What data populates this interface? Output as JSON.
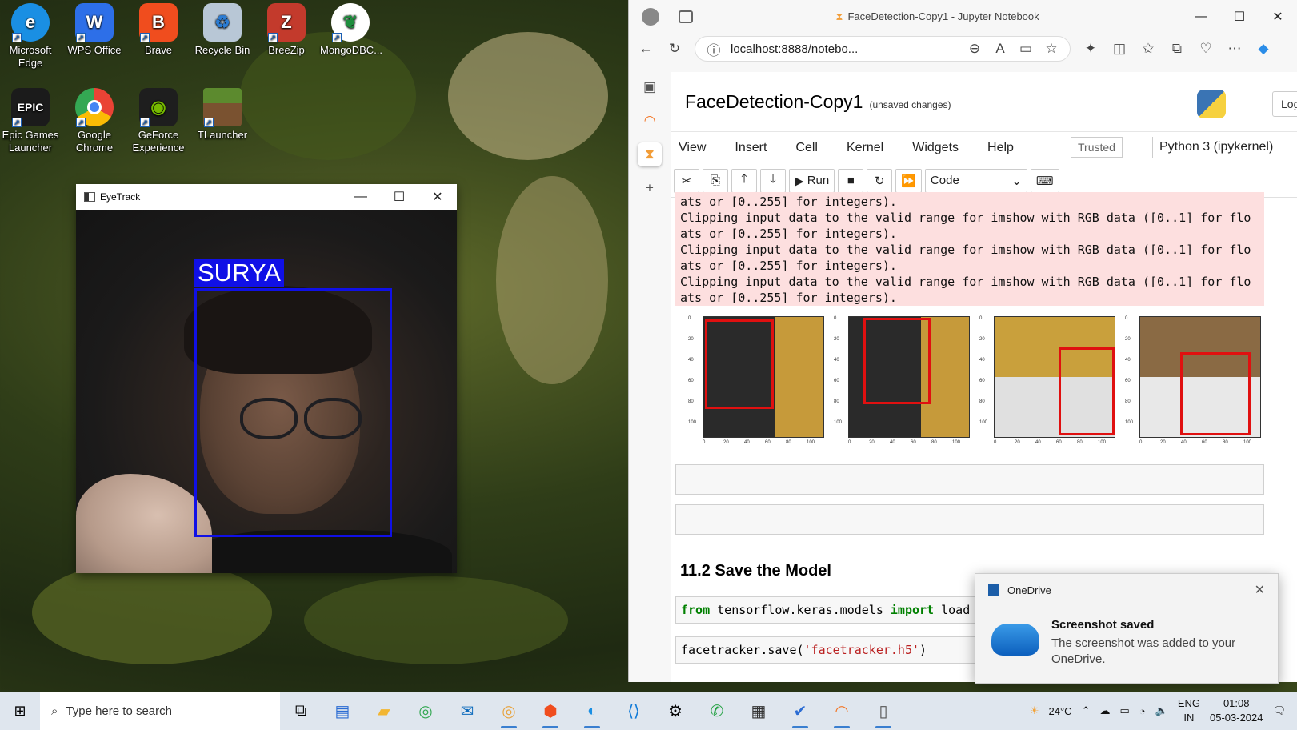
{
  "desktop": {
    "icons": [
      {
        "label1": "Microsoft",
        "label2": "Edge",
        "color": "#1a8fe3",
        "glyph": "e"
      },
      {
        "label1": "WPS Office",
        "label2": "",
        "color": "#2d6fe8",
        "glyph": "W"
      },
      {
        "label1": "Brave",
        "label2": "",
        "color": "#f04d1e",
        "glyph": "B"
      },
      {
        "label1": "Recycle Bin",
        "label2": "",
        "color": "#b8c7d6",
        "glyph": "♻"
      },
      {
        "label1": "BreeZip",
        "label2": "",
        "color": "#c33a2c",
        "glyph": "Z"
      },
      {
        "label1": "MongoDBC...",
        "label2": "",
        "color": "#ffffff",
        "glyph": "🍃"
      },
      {
        "label1": "Epic Games",
        "label2": "Launcher",
        "color": "#1b1b1b",
        "glyph": "EPIC"
      },
      {
        "label1": "Google",
        "label2": "Chrome",
        "color": "#e8e8e8",
        "glyph": "◎"
      },
      {
        "label1": "GeForce",
        "label2": "Experience",
        "color": "#1e1e1e",
        "glyph": "◉"
      },
      {
        "label1": "TLauncher",
        "label2": "",
        "color": "#5c8a2e",
        "glyph": "▦"
      }
    ]
  },
  "eyetrack": {
    "title": "EyeTrack",
    "face_label": "SURYA"
  },
  "browser": {
    "window_title": "FaceDetection-Copy1 - Jupyter Notebook",
    "url": "localhost:8888/notebo...",
    "notebook_title": "FaceDetection-Copy1",
    "unsaved": "(unsaved changes)",
    "logout": "Logou",
    "menu": [
      "View",
      "Insert",
      "Cell",
      "Kernel",
      "Widgets",
      "Help"
    ],
    "trusted": "Trusted",
    "kernel": "Python 3 (ipykernel)",
    "run_label": "Run",
    "cell_type": "Code",
    "stderr_text": "ats or [0..255] for integers).\nClipping input data to the valid range for imshow with RGB data ([0..1] for flo\nats or [0..255] for integers).\nClipping input data to the valid range for imshow with RGB data ([0..1] for flo\nats or [0..255] for integers).\nClipping input data to the valid range for imshow with RGB data ([0..1] for flo\nats or [0..255] for integers).",
    "y_ticks": [
      "0",
      "20",
      "40",
      "60",
      "80",
      "100"
    ],
    "x_ticks": [
      "0",
      "20",
      "40",
      "60",
      "80",
      "100"
    ],
    "heading": "11.2 Save the Model",
    "code1": {
      "kw1": "from",
      "mod": " tensorflow.keras.models ",
      "kw2": "import",
      "rest": " load"
    },
    "code2": {
      "pre": "facetracker.save(",
      "str": "'facetracker.h5'",
      "post": ")"
    }
  },
  "toast": {
    "app": "OneDrive",
    "title": "Screenshot saved",
    "body": "The screenshot was added to your OneDrive."
  },
  "taskbar": {
    "search_placeholder": "Type here to search",
    "weather": "24°C",
    "lang1": "ENG",
    "lang2": "IN",
    "time": "01:08",
    "date": "05-03-2024"
  }
}
